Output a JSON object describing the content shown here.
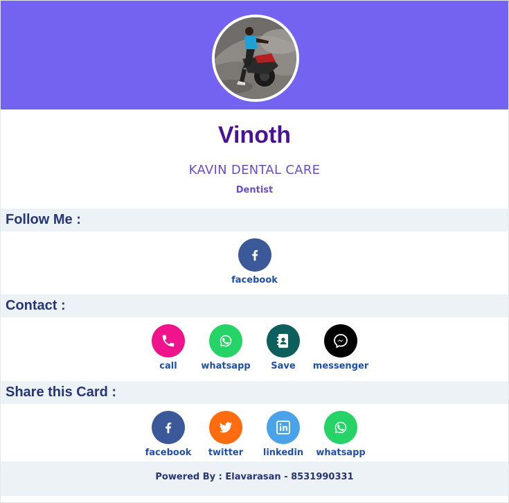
{
  "profile": {
    "name": "Vinoth",
    "company": "KAVIN DENTAL CARE",
    "role": "Dentist"
  },
  "sections": {
    "follow": {
      "title": "Follow Me :",
      "items": [
        {
          "label": "facebook",
          "icon": "facebook-icon",
          "color": "#3b5998"
        }
      ]
    },
    "contact": {
      "title": "Contact :",
      "items": [
        {
          "label": "call",
          "icon": "phone-icon",
          "color": "#f0148c"
        },
        {
          "label": "whatsapp",
          "icon": "whatsapp-icon",
          "color": "#25d366"
        },
        {
          "label": "Save",
          "icon": "contact-book-icon",
          "color": "#0d5f5c"
        },
        {
          "label": "messenger",
          "icon": "messenger-icon",
          "color": "#000000"
        }
      ]
    },
    "share": {
      "title": "Share this Card :",
      "items": [
        {
          "label": "facebook",
          "icon": "facebook-icon",
          "color": "#3b5998"
        },
        {
          "label": "twitter",
          "icon": "twitter-icon",
          "color": "#ff6c0f"
        },
        {
          "label": "linkedin",
          "icon": "linkedin-icon",
          "color": "#4aa3e8"
        },
        {
          "label": "whatsapp",
          "icon": "whatsapp-icon",
          "color": "#25d366"
        }
      ]
    }
  },
  "footer": {
    "text": "Powered By : Elavarasan - 8531990331"
  },
  "colors": {
    "header": "#7363f0",
    "name": "#4a1396",
    "section_bg": "#edf2f7",
    "label": "#1f4fa8"
  }
}
